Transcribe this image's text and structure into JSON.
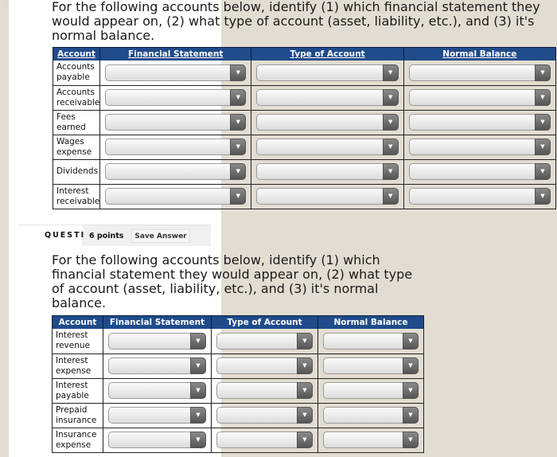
{
  "question1": {
    "prompt_lines": [
      "For the following accounts below, identify (1) which financial statement they",
      "would appear on, (2) what type of account (asset, liability, etc.), and (3) it's",
      "normal balance."
    ],
    "columns": [
      "Account",
      "Financial Statement",
      "Type of Account",
      "Normal Balance"
    ],
    "rows": [
      {
        "account": [
          "Accounts",
          "payable"
        ],
        "financial_statement": "",
        "type_of_account": "",
        "normal_balance": ""
      },
      {
        "account": [
          "Accounts",
          "receivable"
        ],
        "financial_statement": "",
        "type_of_account": "",
        "normal_balance": ""
      },
      {
        "account": [
          "Fees",
          "earned"
        ],
        "financial_statement": "",
        "type_of_account": "",
        "normal_balance": ""
      },
      {
        "account": [
          "Wages",
          "expense"
        ],
        "financial_statement": "",
        "type_of_account": "",
        "normal_balance": ""
      },
      {
        "account": [
          "Dividends"
        ],
        "financial_statement": "",
        "type_of_account": "",
        "normal_balance": ""
      },
      {
        "account": [
          "Interest",
          "receivable"
        ],
        "financial_statement": "",
        "type_of_account": "",
        "normal_balance": ""
      }
    ]
  },
  "question2": {
    "label": "QUESTI",
    "points": "6 points",
    "save_label": "Save Answer",
    "prompt_lines": [
      "For the following accounts below, identify (1) which",
      "financial statement they would appear on, (2) what type",
      "of account (asset, liability, etc.), and (3) it's normal",
      "balance."
    ],
    "columns": [
      "Account",
      "Financial Statement",
      "Type of Account",
      "Normal Balance"
    ],
    "rows": [
      {
        "account": [
          "Interest",
          "revenue"
        ],
        "financial_statement": "",
        "type_of_account": "",
        "normal_balance": ""
      },
      {
        "account": [
          "Interest",
          "expense"
        ],
        "financial_statement": "",
        "type_of_account": "",
        "normal_balance": ""
      },
      {
        "account": [
          "Interest",
          "payable"
        ],
        "financial_statement": "",
        "type_of_account": "",
        "normal_balance": ""
      },
      {
        "account": [
          "Prepaid",
          "insurance"
        ],
        "financial_statement": "",
        "type_of_account": "",
        "normal_balance": ""
      },
      {
        "account": [
          "Insurance",
          "expense"
        ],
        "financial_statement": "",
        "type_of_account": "",
        "normal_balance": ""
      }
    ]
  },
  "icons": {
    "dropdown_arrow": "▼"
  },
  "colors": {
    "header_bg": "#1f4b8a",
    "page_bg": "#f1eee7",
    "panel_bg": "#ffffff"
  }
}
